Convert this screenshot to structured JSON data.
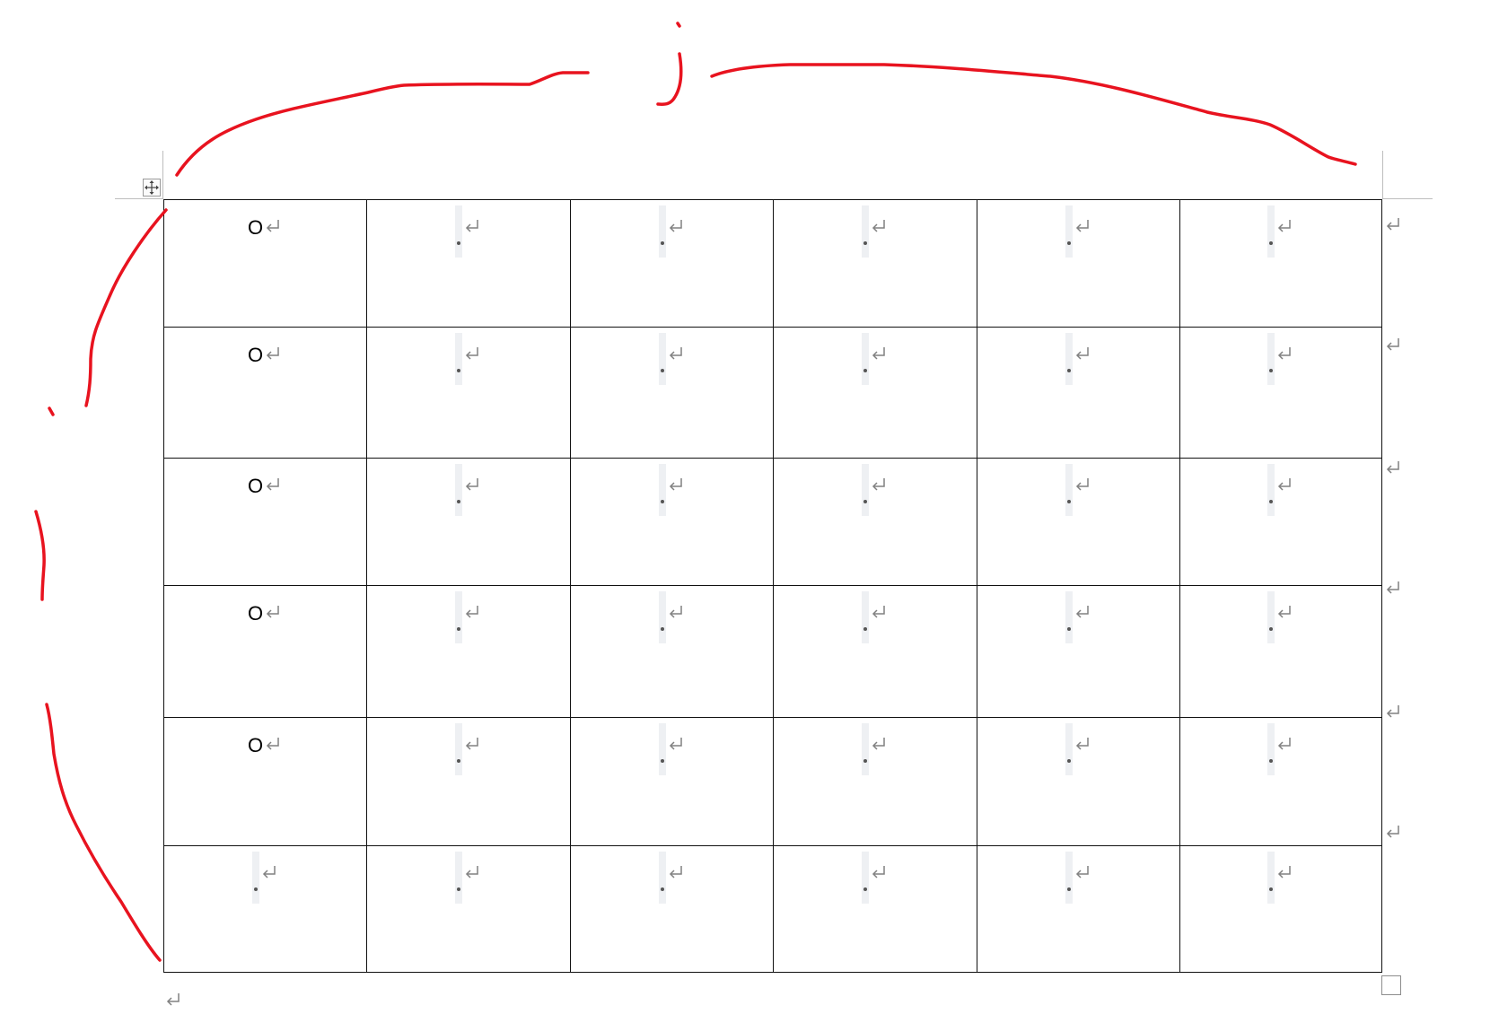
{
  "document": {
    "table": {
      "rows": [
        {
          "cells": [
            "O",
            "",
            "",
            "",
            "",
            ""
          ]
        },
        {
          "cells": [
            "O",
            "",
            "",
            "",
            "",
            ""
          ]
        },
        {
          "cells": [
            "O",
            "",
            "",
            "",
            "",
            ""
          ]
        },
        {
          "cells": [
            "O",
            "",
            "",
            "",
            "",
            ""
          ]
        },
        {
          "cells": [
            "O",
            "",
            "",
            "",
            "",
            ""
          ]
        },
        {
          "cells": [
            "",
            "",
            "",
            "",
            "",
            ""
          ]
        }
      ]
    },
    "formatting_marks": {
      "paragraph_mark": "return-arrow-icon",
      "mark_color": "#808080"
    }
  },
  "ink": {
    "color": "#e8131f",
    "strokes": [
      "top-arc",
      "dot-j",
      "hook-j",
      "left-arc",
      "left-tick",
      "left-stroke-mid",
      "left-stroke-bottom"
    ]
  }
}
